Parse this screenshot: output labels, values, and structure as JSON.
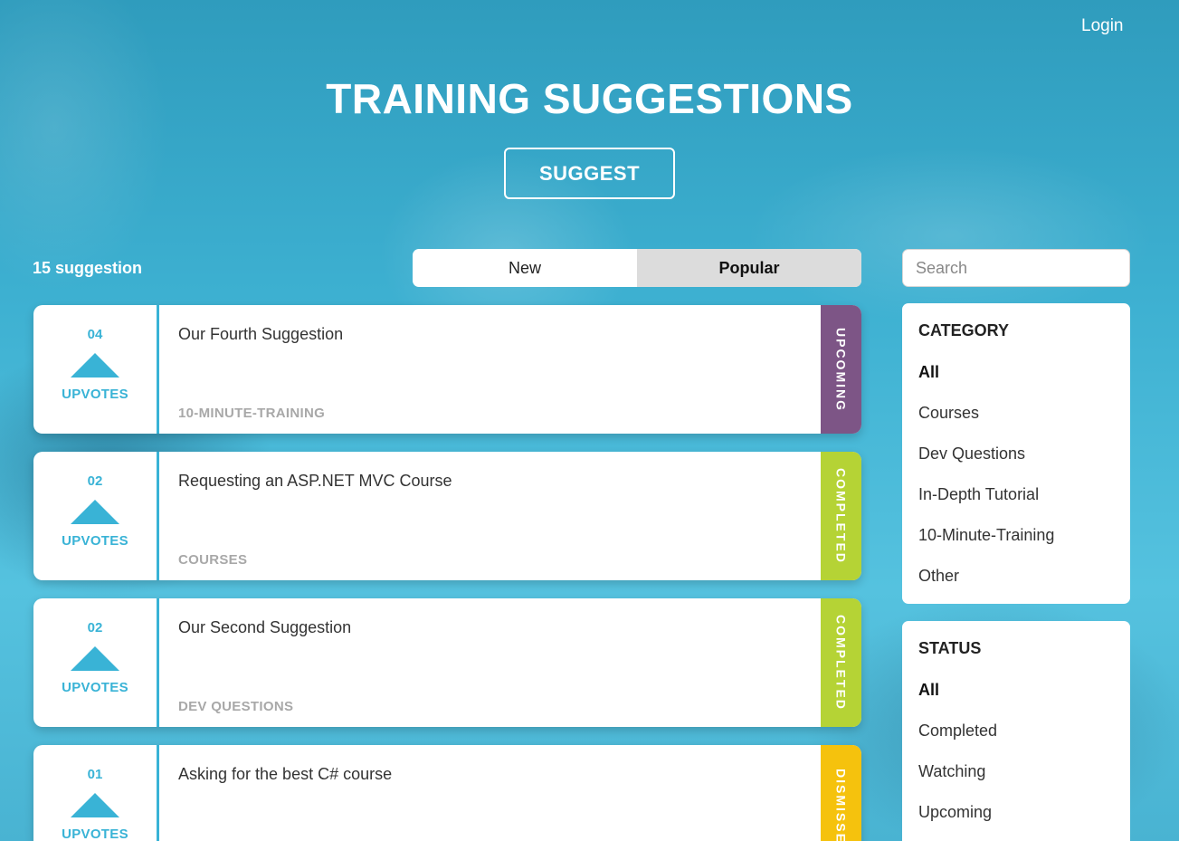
{
  "header": {
    "login_label": "Login",
    "title": "TRAINING SUGGESTIONS",
    "suggest_label": "SUGGEST"
  },
  "toolbar": {
    "count_text": "15 suggestion",
    "sort_new_label": "New",
    "sort_popular_label": "Popular",
    "active_sort": "Popular",
    "search_placeholder": "Search"
  },
  "suggestions": [
    {
      "votes": "04",
      "vote_label": "UPVOTES",
      "title": "Our Fourth Suggestion",
      "category": "10-MINUTE-TRAINING",
      "status": "UPCOMING",
      "status_color": "#7d5586"
    },
    {
      "votes": "02",
      "vote_label": "UPVOTES",
      "title": "Requesting an ASP.NET MVC Course",
      "category": "COURSES",
      "status": "COMPLETED",
      "status_color": "#b5d335"
    },
    {
      "votes": "02",
      "vote_label": "UPVOTES",
      "title": "Our Second Suggestion",
      "category": "DEV QUESTIONS",
      "status": "COMPLETED",
      "status_color": "#b5d335"
    },
    {
      "votes": "01",
      "vote_label": "UPVOTES",
      "title": "Asking for the best C# course",
      "category": "",
      "status": "DISMISSED",
      "status_color": "#f5c20d"
    }
  ],
  "category_panel": {
    "heading": "CATEGORY",
    "items": [
      "All",
      "Courses",
      "Dev Questions",
      "In-Depth Tutorial",
      "10-Minute-Training",
      "Other"
    ],
    "active": "All"
  },
  "status_panel": {
    "heading": "STATUS",
    "items": [
      "All",
      "Completed",
      "Watching",
      "Upcoming"
    ],
    "active": "All"
  },
  "colors": {
    "accent": "#39b3d6",
    "background": "#4fb9d6"
  }
}
